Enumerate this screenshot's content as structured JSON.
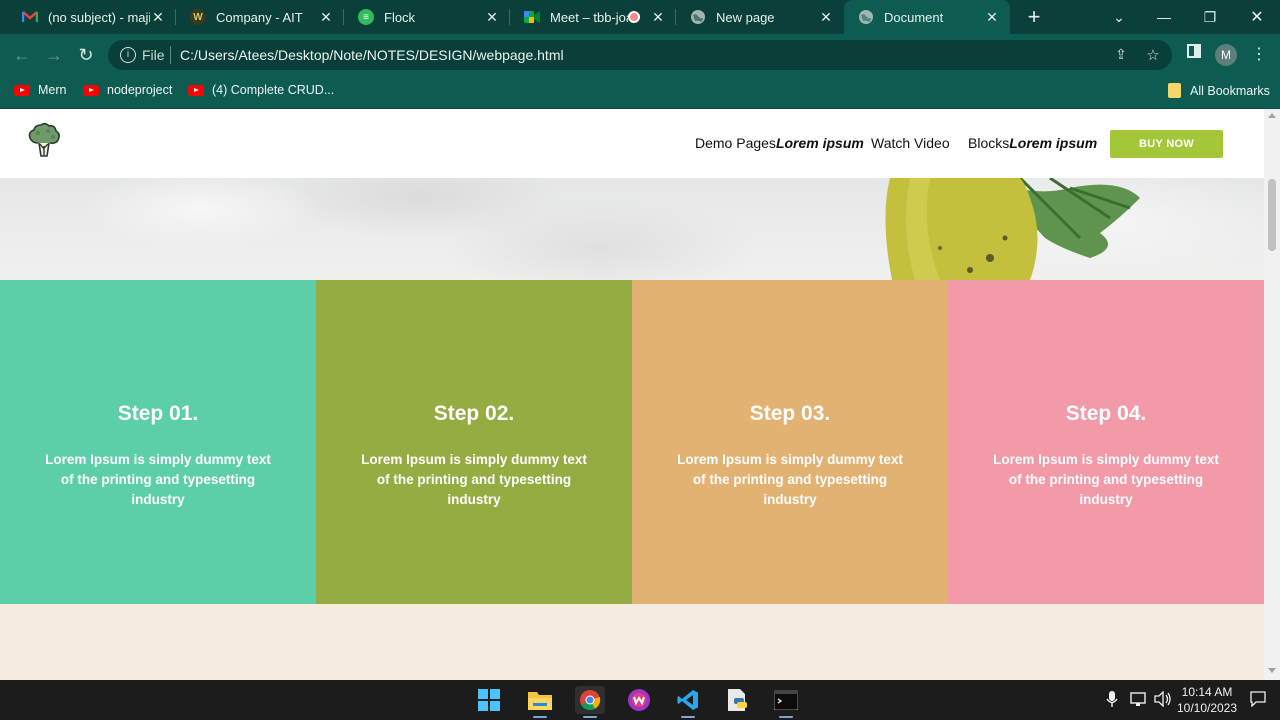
{
  "browser": {
    "tabs": [
      {
        "title": "(no subject) - majit",
        "icon": "gmail-icon"
      },
      {
        "title": "Company - AIT",
        "icon": "company-icon"
      },
      {
        "title": "Flock",
        "icon": "flock-icon"
      },
      {
        "title": "Meet – tbb-joa",
        "icon": "meet-icon"
      },
      {
        "title": "New page",
        "icon": "globe-icon"
      },
      {
        "title": "Document",
        "icon": "globe-icon",
        "active": true
      }
    ],
    "address": {
      "scheme_label": "File",
      "url": "C:/Users/Atees/Desktop/Note/NOTES/DESIGN/webpage.html"
    },
    "profile_initial": "M",
    "bookmarks": [
      {
        "label": "Mern"
      },
      {
        "label": "nodeproject"
      },
      {
        "label": "(4) Complete CRUD..."
      }
    ],
    "all_bookmarks_label": "All Bookmarks"
  },
  "site": {
    "nav": [
      {
        "text": "Demo Pages",
        "italic": "Lorem ipsum"
      },
      {
        "text": "Watch Video",
        "italic": ""
      },
      {
        "text": "Blocks",
        "italic": "Lorem ipsum"
      }
    ],
    "buy_label": "BUY NOW",
    "steps": [
      {
        "title": "Step 01.",
        "text": "Lorem Ipsum is simply dummy text of the printing and typesetting industry",
        "color": "#5ccea8"
      },
      {
        "title": "Step 02.",
        "text": "Lorem Ipsum is simply dummy text of the printing and typesetting industry",
        "color": "#95ac42"
      },
      {
        "title": "Step 03.",
        "text": "Lorem Ipsum is simply dummy text of the printing and typesetting industry",
        "color": "#e2b273"
      },
      {
        "title": "Step 04.",
        "text": "Lorem Ipsum is simply dummy text of the printing and typesetting industry",
        "color": "#f39aa9"
      }
    ]
  },
  "taskbar": {
    "time": "10:14 AM",
    "date": "10/10/2023"
  }
}
